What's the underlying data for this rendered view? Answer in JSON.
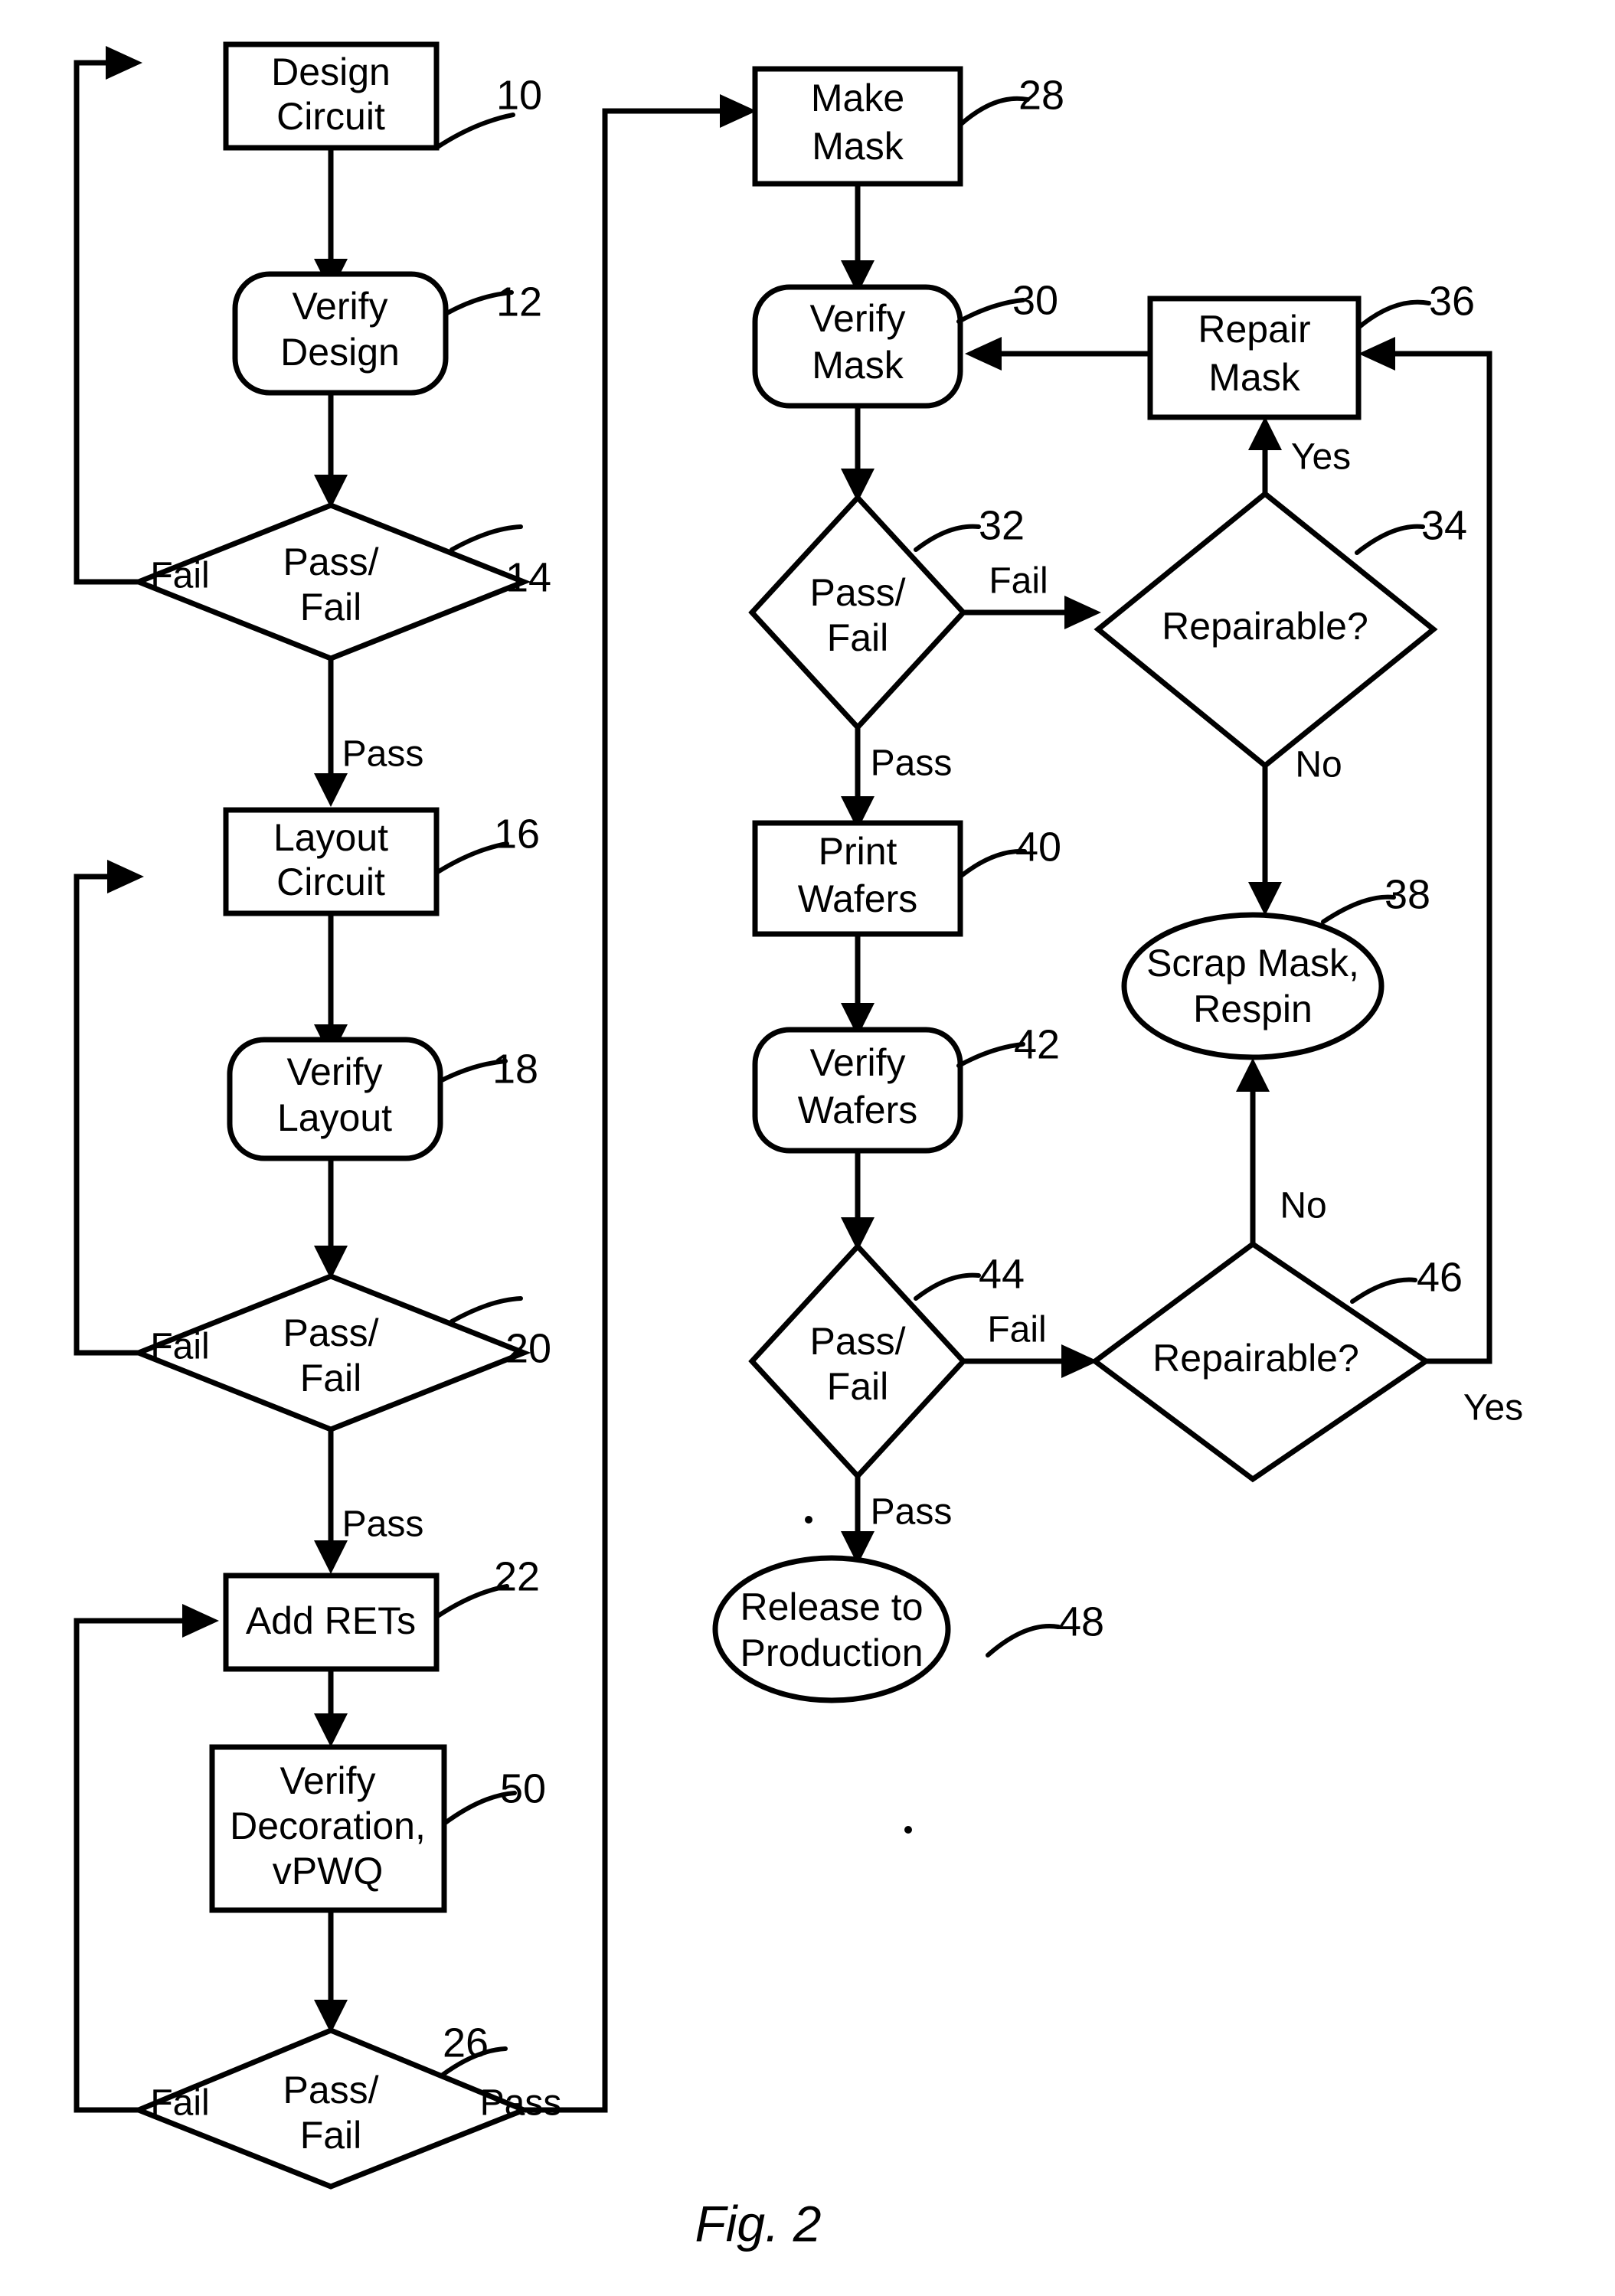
{
  "figure": {
    "caption": "Fig. 2"
  },
  "nodes": {
    "design_circuit": {
      "id": "10",
      "label_line1": "Design",
      "label_line2": "Circuit",
      "shape": "rectangle"
    },
    "verify_design": {
      "id": "12",
      "label_line1": "Verify",
      "label_line2": "Design",
      "shape": "rounded-rectangle"
    },
    "pass_fail_14": {
      "id": "14",
      "label_line1": "Pass/",
      "label_line2": "Fail",
      "shape": "diamond"
    },
    "layout_circuit": {
      "id": "16",
      "label_line1": "Layout",
      "label_line2": "Circuit",
      "shape": "rectangle"
    },
    "verify_layout": {
      "id": "18",
      "label_line1": "Verify",
      "label_line2": "Layout",
      "shape": "rounded-rectangle"
    },
    "pass_fail_20": {
      "id": "20",
      "label_line1": "Pass/",
      "label_line2": "Fail",
      "shape": "diamond"
    },
    "add_rets": {
      "id": "22",
      "label_line1": "Add RETs",
      "label_line2": "",
      "shape": "rectangle"
    },
    "verify_decoration": {
      "id": "50",
      "label_line1": "Verify",
      "label_line2": "Decoration,",
      "label_line3": "vPWQ",
      "shape": "rectangle"
    },
    "pass_fail_26": {
      "id": "26",
      "label_line1": "Pass/",
      "label_line2": "Fail",
      "shape": "diamond"
    },
    "make_mask": {
      "id": "28",
      "label_line1": "Make",
      "label_line2": "Mask",
      "shape": "rectangle"
    },
    "verify_mask": {
      "id": "30",
      "label_line1": "Verify",
      "label_line2": "Mask",
      "shape": "rounded-rectangle"
    },
    "pass_fail_32": {
      "id": "32",
      "label_line1": "Pass/",
      "label_line2": "Fail",
      "shape": "diamond"
    },
    "repairable_34": {
      "id": "34",
      "label_line1": "Repairable?",
      "label_line2": "",
      "shape": "diamond"
    },
    "repair_mask": {
      "id": "36",
      "label_line1": "Repair",
      "label_line2": "Mask",
      "shape": "rectangle"
    },
    "scrap_mask": {
      "id": "38",
      "label_line1": "Scrap Mask,",
      "label_line2": "Respin",
      "shape": "ellipse"
    },
    "print_wafers": {
      "id": "40",
      "label_line1": "Print",
      "label_line2": "Wafers",
      "shape": "rectangle"
    },
    "verify_wafers": {
      "id": "42",
      "label_line1": "Verify",
      "label_line2": "Wafers",
      "shape": "rounded-rectangle"
    },
    "pass_fail_44": {
      "id": "44",
      "label_line1": "Pass/",
      "label_line2": "Fail",
      "shape": "diamond"
    },
    "repairable_46": {
      "id": "46",
      "label_line1": "Repairable?",
      "label_line2": "",
      "shape": "diamond"
    },
    "release_production": {
      "id": "48",
      "label_line1": "Release to",
      "label_line2": "Production",
      "shape": "ellipse"
    }
  },
  "edge_labels": {
    "fail_14": "Fail",
    "pass_14": "Pass",
    "fail_20": "Fail",
    "pass_20": "Pass",
    "fail_26": "Fail",
    "pass_26": "Pass",
    "fail_32": "Fail",
    "pass_32": "Pass",
    "yes_34": "Yes",
    "no_34": "No",
    "fail_44": "Fail",
    "pass_44": "Pass",
    "yes_46": "Yes",
    "no_46": "No"
  },
  "colors": {
    "stroke": "#000000",
    "fill": "#ffffff",
    "background": "#ffffff"
  }
}
